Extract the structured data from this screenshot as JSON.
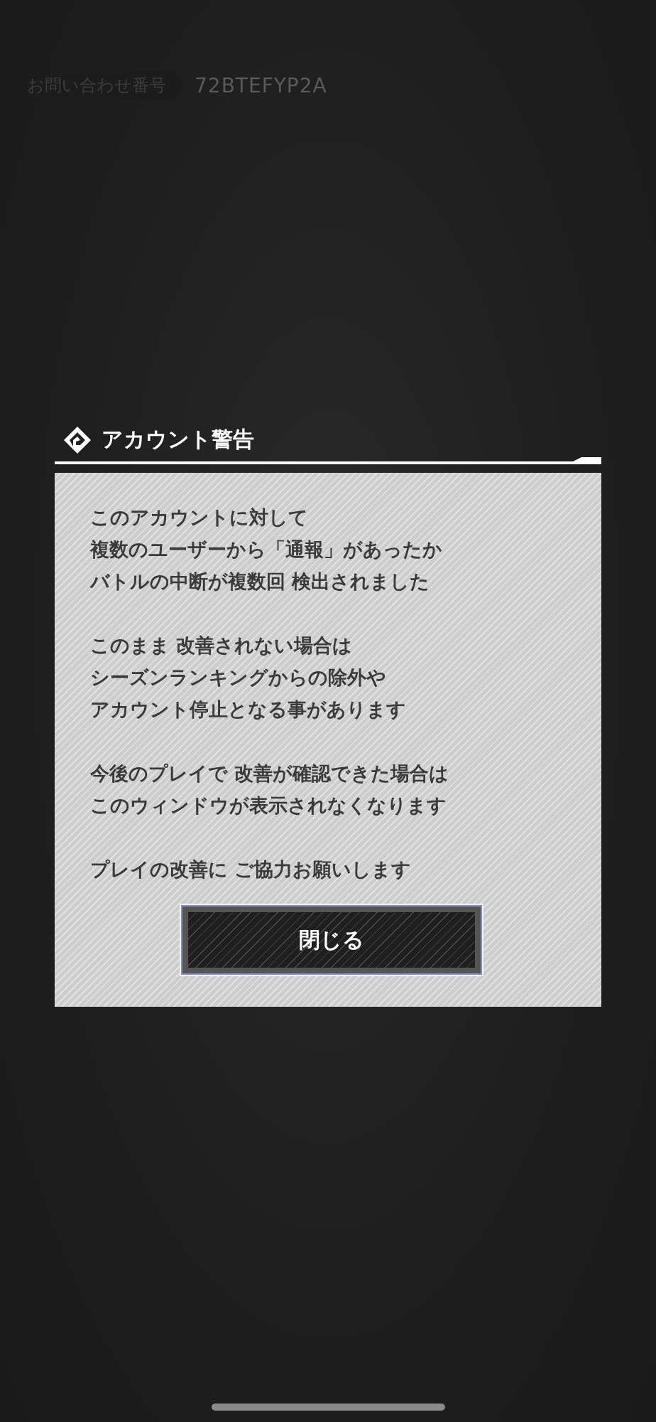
{
  "inquiry": {
    "label": "お問い合わせ番号",
    "number": "72BTEFYP2A"
  },
  "dialog": {
    "title": "アカウント警告",
    "paragraphs": [
      [
        "このアカウントに対して",
        "複数のユーザーから「通報」があったか",
        "バトルの中断が複数回 検出されました"
      ],
      [
        "このまま 改善されない場合は",
        "シーズンランキングからの除外や",
        "アカウント停止となる事があります"
      ],
      [
        "今後のプレイで 改善が確認できた場合は",
        "このウィンドウが表示されなくなります"
      ],
      [
        "プレイの改善に ご協力お願いします"
      ]
    ],
    "button": "閉じる"
  }
}
